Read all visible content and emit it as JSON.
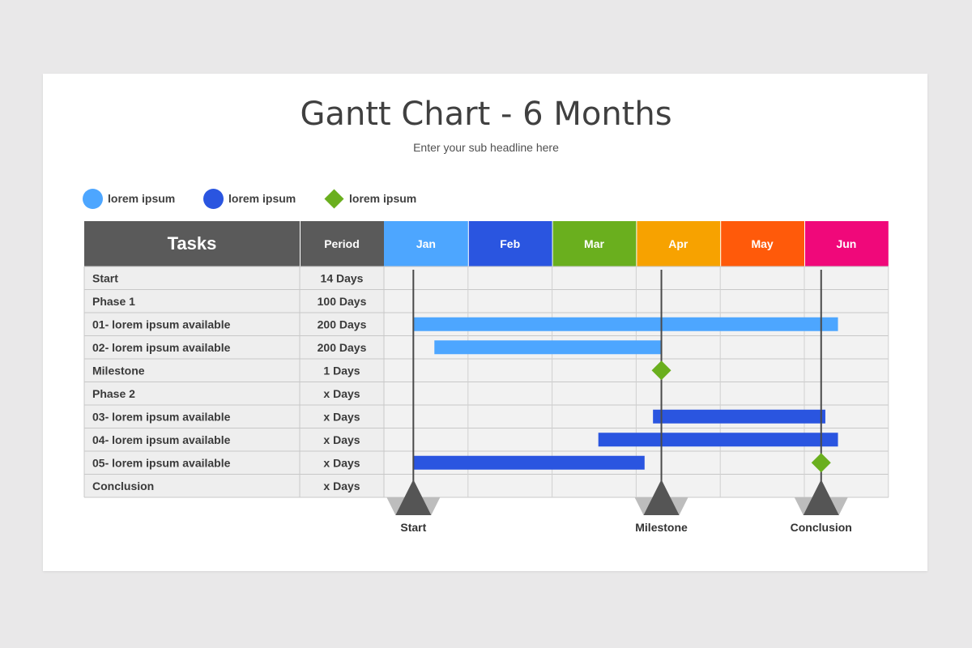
{
  "title": "Gantt Chart - 6 Months",
  "subtitle": "Enter your sub headline here",
  "legend": [
    {
      "label": "lorem ipsum",
      "shape": "circle",
      "color": "#4da6ff"
    },
    {
      "label": "lorem ipsum",
      "shape": "circle",
      "color": "#2a55e0"
    },
    {
      "label": "lorem ipsum",
      "shape": "diamond",
      "color": "#6aaf1e"
    }
  ],
  "chart_data": {
    "type": "gantt",
    "title": "Gantt Chart - 6 Months",
    "subtitle": "Enter your sub headline here",
    "columns": {
      "tasks": "Tasks",
      "period": "Period"
    },
    "header_color": "#5a5a5a",
    "months": [
      {
        "name": "Jan",
        "color": "#4da6ff"
      },
      {
        "name": "Feb",
        "color": "#2a55e0"
      },
      {
        "name": "Mar",
        "color": "#6aaf1e"
      },
      {
        "name": "Apr",
        "color": "#f7a200"
      },
      {
        "name": "May",
        "color": "#ff5a0a"
      },
      {
        "name": "Jun",
        "color": "#f0087a"
      }
    ],
    "rows": [
      {
        "task": "Start",
        "period": "14 Days"
      },
      {
        "task": "Phase 1",
        "period": "100 Days"
      },
      {
        "task": "01- lorem ipsum available",
        "period": "200 Days",
        "bar": {
          "start": 0.35,
          "end": 5.4,
          "color": "#4da6ff"
        }
      },
      {
        "task": "02- lorem ipsum available",
        "period": "200 Days",
        "bar": {
          "start": 0.6,
          "end": 3.3,
          "color": "#4da6ff"
        }
      },
      {
        "task": "Milestone",
        "period": "1 Days",
        "diamond": {
          "at": 3.3,
          "color": "#6aaf1e"
        }
      },
      {
        "task": "Phase 2",
        "period": "x Days"
      },
      {
        "task": "03- lorem ipsum available",
        "period": "x Days",
        "bar": {
          "start": 3.2,
          "end": 5.25,
          "color": "#2a55e0"
        }
      },
      {
        "task": "04- lorem ipsum available",
        "period": "x Days",
        "bar": {
          "start": 2.55,
          "end": 5.4,
          "color": "#2a55e0"
        }
      },
      {
        "task": "05- lorem ipsum available",
        "period": "x Days",
        "bar": {
          "start": 0.35,
          "end": 3.1,
          "color": "#2a55e0"
        },
        "diamond": {
          "at": 5.2,
          "color": "#6aaf1e"
        }
      },
      {
        "task": "Conclusion",
        "period": "x Days"
      }
    ],
    "markers": [
      {
        "label": "Start",
        "at": 0.35
      },
      {
        "label": "Milestone",
        "at": 3.3
      },
      {
        "label": "Conclusion",
        "at": 5.2
      }
    ]
  }
}
